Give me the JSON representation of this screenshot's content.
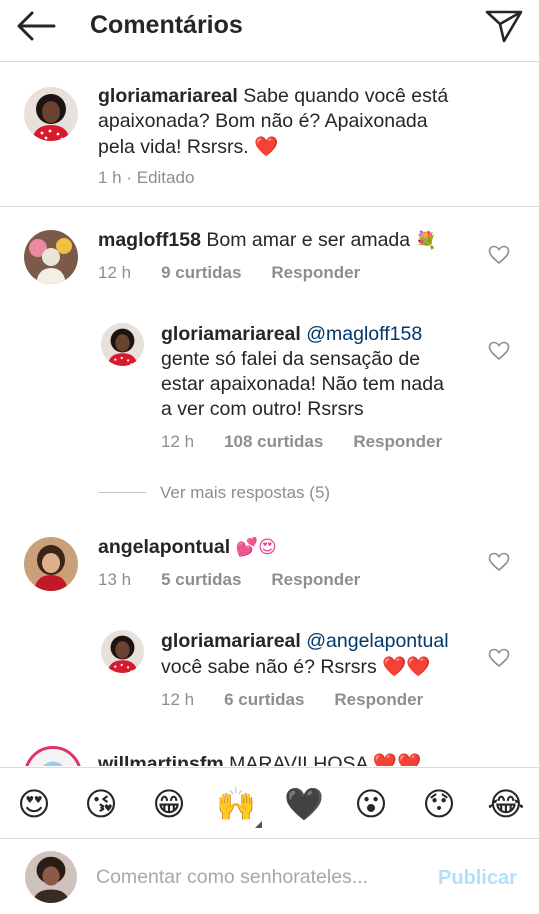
{
  "header": {
    "title": "Comentários"
  },
  "caption": {
    "username": "gloriamariareal",
    "text_line1": " Sabe quando você está",
    "text_line2": "apaixonada? Bom não é? Apaixonada",
    "text_line3": "pela vida! Rsrsrs. ",
    "emoji": "❤️",
    "meta": "1 h · Editado"
  },
  "comments": [
    {
      "username": "magloff158",
      "text": " Bom amar e ser amada ",
      "emoji": "💐",
      "time": "12 h",
      "likes": "9 curtidas",
      "reply": "Responder",
      "replies": [
        {
          "username": "gloriamariareal",
          "mention": " @magloff158",
          "line1": "gente só falei da sensação de",
          "line2": "estar apaixonada! Não tem nada",
          "line3": "a ver com outro! Rsrsrs",
          "time": "12 h",
          "likes": "108 curtidas",
          "reply": "Responder"
        }
      ],
      "view_more": "Ver mais respostas (5)"
    },
    {
      "username": "angelapontual",
      "text": " ",
      "emoji": "💕😍",
      "time": "13 h",
      "likes": "5 curtidas",
      "reply": "Responder",
      "replies": [
        {
          "username": "gloriamariareal",
          "mention": " @angelapontual",
          "line1": "você sabe não é? Rsrsrs ",
          "emoji": "❤️❤️",
          "time": "12 h",
          "likes": "6 curtidas",
          "reply": "Responder"
        }
      ]
    },
    {
      "username": "willmartinsfm",
      "text": " MARAVILHOSA ",
      "emoji": "❤️❤️"
    }
  ],
  "emoji_bar": [
    "😍",
    "😘",
    "😁",
    "🙌",
    "🖤",
    "😮",
    "😯",
    "😂"
  ],
  "composer": {
    "placeholder": "Comentar como senhorateles...",
    "publish": "Publicar"
  },
  "colors": {
    "text": "#262626",
    "muted": "#8e8e8e",
    "mention": "#00376b",
    "heart_red": "#ed1c24",
    "publish_disabled": "#b2dffc"
  }
}
